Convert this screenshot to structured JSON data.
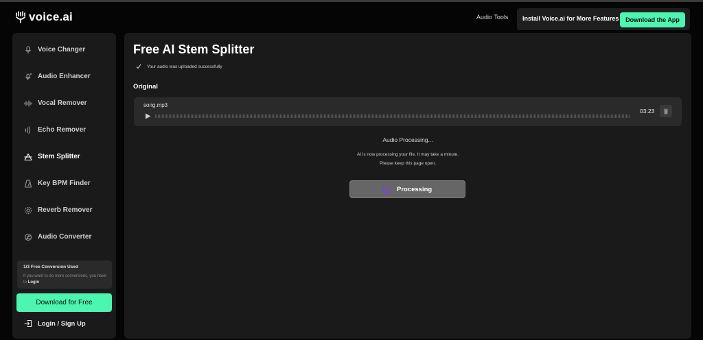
{
  "header": {
    "brand": "voice.ai",
    "nav_audio_tools": "Audio Tools",
    "install_text": "Install Voice.ai for More Features",
    "download_app_label": "Download the App"
  },
  "sidebar": {
    "items": [
      {
        "label": "Voice Changer",
        "icon": "microphone-icon"
      },
      {
        "label": "Audio Enhancer",
        "icon": "microphone-sparkle-icon"
      },
      {
        "label": "Vocal Remover",
        "icon": "waveform-icon"
      },
      {
        "label": "Echo Remover",
        "icon": "echo-waves-icon"
      },
      {
        "label": "Stem Splitter",
        "icon": "stem-splitter-icon",
        "active": true
      },
      {
        "label": "Key BPM Finder",
        "icon": "metronome-icon"
      },
      {
        "label": "Reverb Remover",
        "icon": "reverb-icon"
      },
      {
        "label": "Audio Converter",
        "icon": "converter-icon"
      }
    ],
    "conversion_title": "1/3 Free Conversion Used",
    "conversion_text": "If you want to do more conversions, you have to",
    "conversion_login": "Login",
    "download_free_label": "Download for Free",
    "login_label": "Login / Sign Up"
  },
  "main": {
    "title": "Free AI Stem Splitter",
    "upload_status": "Your audio was uploaded successfully",
    "section_label": "Original",
    "file": {
      "name": "song.mp3",
      "duration": "03:23"
    },
    "processing_title": "Audio Processing...",
    "processing_line1": "AI is now processing your file. It may take a minute.",
    "processing_line2": "Please keep this page open.",
    "processing_button": "Processing"
  },
  "colors": {
    "accent": "#4cf5b0",
    "background": "#050505",
    "panel": "#1a1a1a",
    "spinner": "#7b3fe4"
  }
}
